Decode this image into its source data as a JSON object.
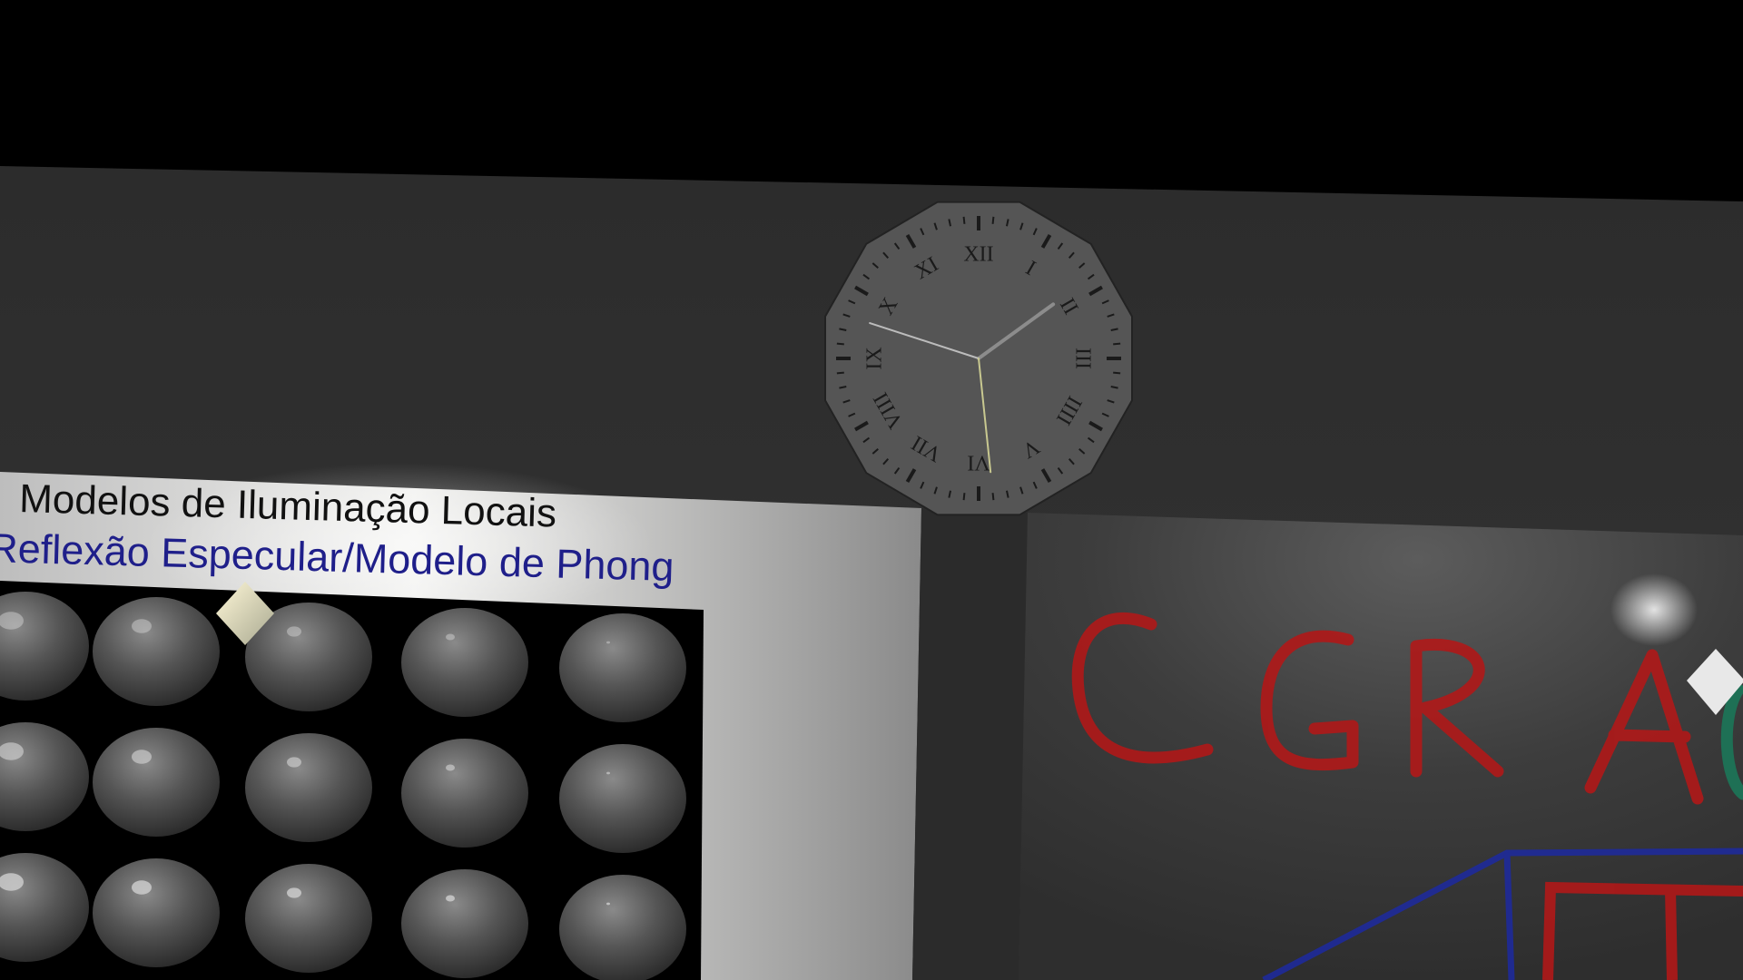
{
  "scene": {
    "colors": {
      "sky": "#000000",
      "wall": "#303030",
      "poster_board": "#e2e2e2",
      "poster_subtitle": "#1f1f8a",
      "sphere_panel": "#000000",
      "clock_face": "#555555",
      "whiteboard": "#3a3a3a",
      "marker_red": "#b01818",
      "marker_blue": "#1e2a9a",
      "marker_green": "#1a7a5a"
    },
    "clock": {
      "numerals": [
        "XII",
        "I",
        "II",
        "III",
        "IIII",
        "V",
        "VI",
        "VII",
        "VIII",
        "IX",
        "X",
        "XI"
      ],
      "time": {
        "hour": 1,
        "minute": 48,
        "second": 29
      }
    },
    "poster": {
      "title": "Modelos de Iluminação Locais",
      "subtitle": "Reflexão Especular/Modelo de Phong",
      "sphere_grid": {
        "rows": 3,
        "columns": 5
      }
    },
    "whiteboard": {
      "drawn_text": "CGRA"
    },
    "lights": [
      "light-lamp-left",
      "light-lamp-right"
    ]
  }
}
